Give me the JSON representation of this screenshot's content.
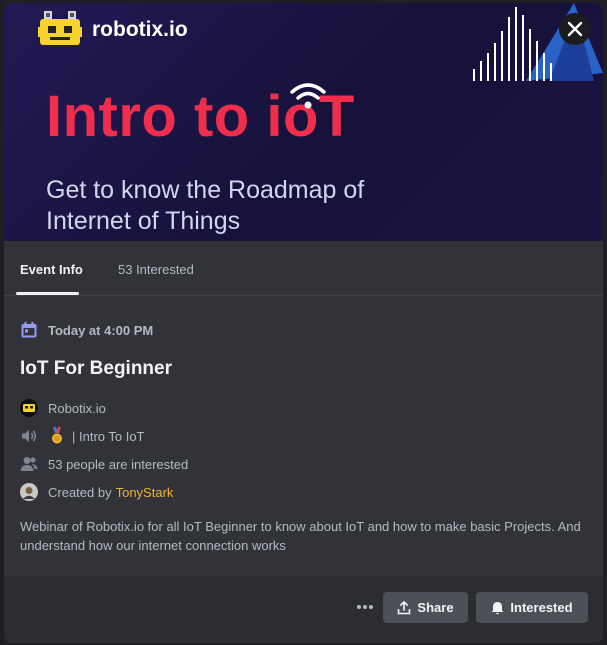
{
  "banner": {
    "brand_name": "robotix.io",
    "title": "Intro to ioT",
    "subtitle": "Get to know the Roadmap of Internet of Things",
    "title_color": "#ee2e4c"
  },
  "tabs": [
    {
      "label": "Event Info",
      "active": true
    },
    {
      "label": "53 Interested",
      "active": false
    }
  ],
  "event": {
    "time": "Today at 4:00 PM",
    "title": "IoT For Beginner",
    "server": "Robotix.io",
    "channel": "| Intro To IoT",
    "interested": "53 people are interested",
    "created_by_prefix": "Created by",
    "creator": "TonyStark",
    "description": "Webinar of Robotix.io for all IoT Beginner to know about IoT and how to make basic Projects. And understand how our internet connection works"
  },
  "footer": {
    "share_label": "Share",
    "interested_label": "Interested"
  },
  "icons": {
    "close": "close-icon",
    "calendar": "calendar-icon",
    "speaker": "speaker-icon",
    "medal": "medal-icon",
    "people": "people-icon",
    "more": "more-icon",
    "share": "share-icon",
    "bell": "bell-icon"
  },
  "colors": {
    "accent_calendar": "#949cf7",
    "creator": "#f0b232",
    "background": "#313338"
  }
}
